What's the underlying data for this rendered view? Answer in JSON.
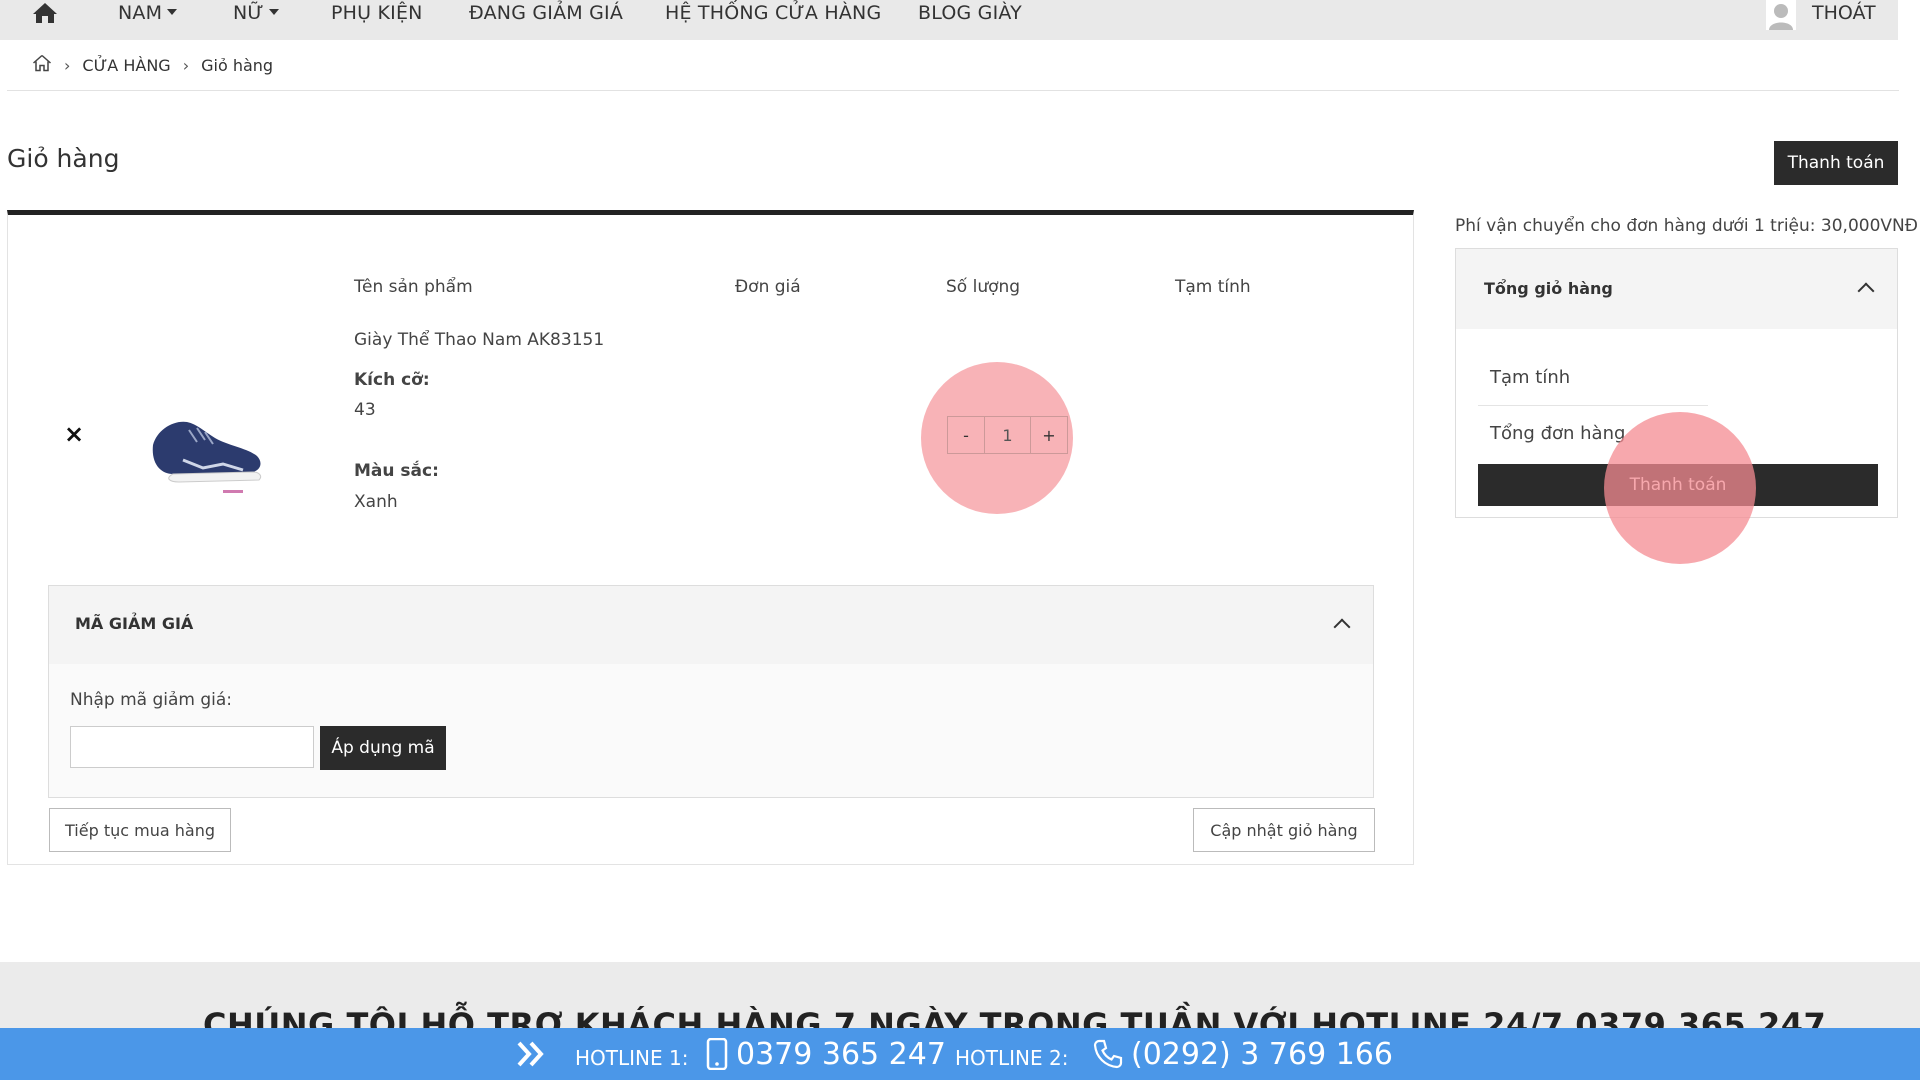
{
  "nav": {
    "items": [
      {
        "label": "NAM",
        "dropdown": true
      },
      {
        "label": "NỮ",
        "dropdown": true
      },
      {
        "label": "PHỤ KIỆN",
        "dropdown": false
      },
      {
        "label": "ĐANG GIẢM GIÁ",
        "dropdown": false
      },
      {
        "label": "HỆ THỐNG CỬA HÀNG",
        "dropdown": false
      },
      {
        "label": "BLOG GIÀY",
        "dropdown": false
      }
    ],
    "logout": "THOÁT"
  },
  "breadcrumb": {
    "store": "CỬA HÀNG",
    "current": "Giỏ hàng"
  },
  "page": {
    "title": "Giỏ hàng",
    "checkout_label": "Thanh toán"
  },
  "cart": {
    "columns": {
      "product": "Tên sản phẩm",
      "price": "Đơn giá",
      "quantity": "Số lượng",
      "subtotal": "Tạm tính"
    },
    "item": {
      "name": "Giày Thể Thao Nam AK83151",
      "size_label": "Kích cỡ:",
      "size": "43",
      "color_label": "Màu sắc:",
      "color": "Xanh",
      "quantity": "1",
      "minus": "-",
      "plus": "+",
      "remove": "×"
    },
    "coupon": {
      "title": "MÃ GIẢM GIÁ",
      "label": "Nhập mã giảm giá:",
      "apply": "Áp dụng mã"
    },
    "continue": "Tiếp tục mua hàng",
    "update": "Cập nhật giỏ hàng"
  },
  "summary": {
    "shipping_note": "Phí vận chuyển cho đơn hàng dưới 1 triệu: 30,000VNĐ",
    "title": "Tổng giỏ hàng",
    "subtotal_label": "Tạm tính",
    "total_label": "Tổng đơn hàng",
    "checkout": "Thanh toán"
  },
  "footer": {
    "support_text": "CHÚNG TÔI HỖ TRỢ KHÁCH HÀNG 7 NGÀY TRONG TUẦN VỚI HOTLINE 24/7    0379 365 247",
    "hotline1_label": "HOTLINE 1:",
    "hotline1": "0379 365 247",
    "hotline2_label": "HOTLINE 2:",
    "hotline2": "(0292) 3 769 166"
  },
  "colors": {
    "accent": "#4b97e8",
    "dark": "#2b2b2b",
    "highlight": "#f48b91"
  },
  "icons": [
    "home-icon",
    "user-icon",
    "breadcrumb-home-icon",
    "chevron-up-icon",
    "double-chevron-icon",
    "mobile-phone-icon",
    "phone-icon"
  ]
}
